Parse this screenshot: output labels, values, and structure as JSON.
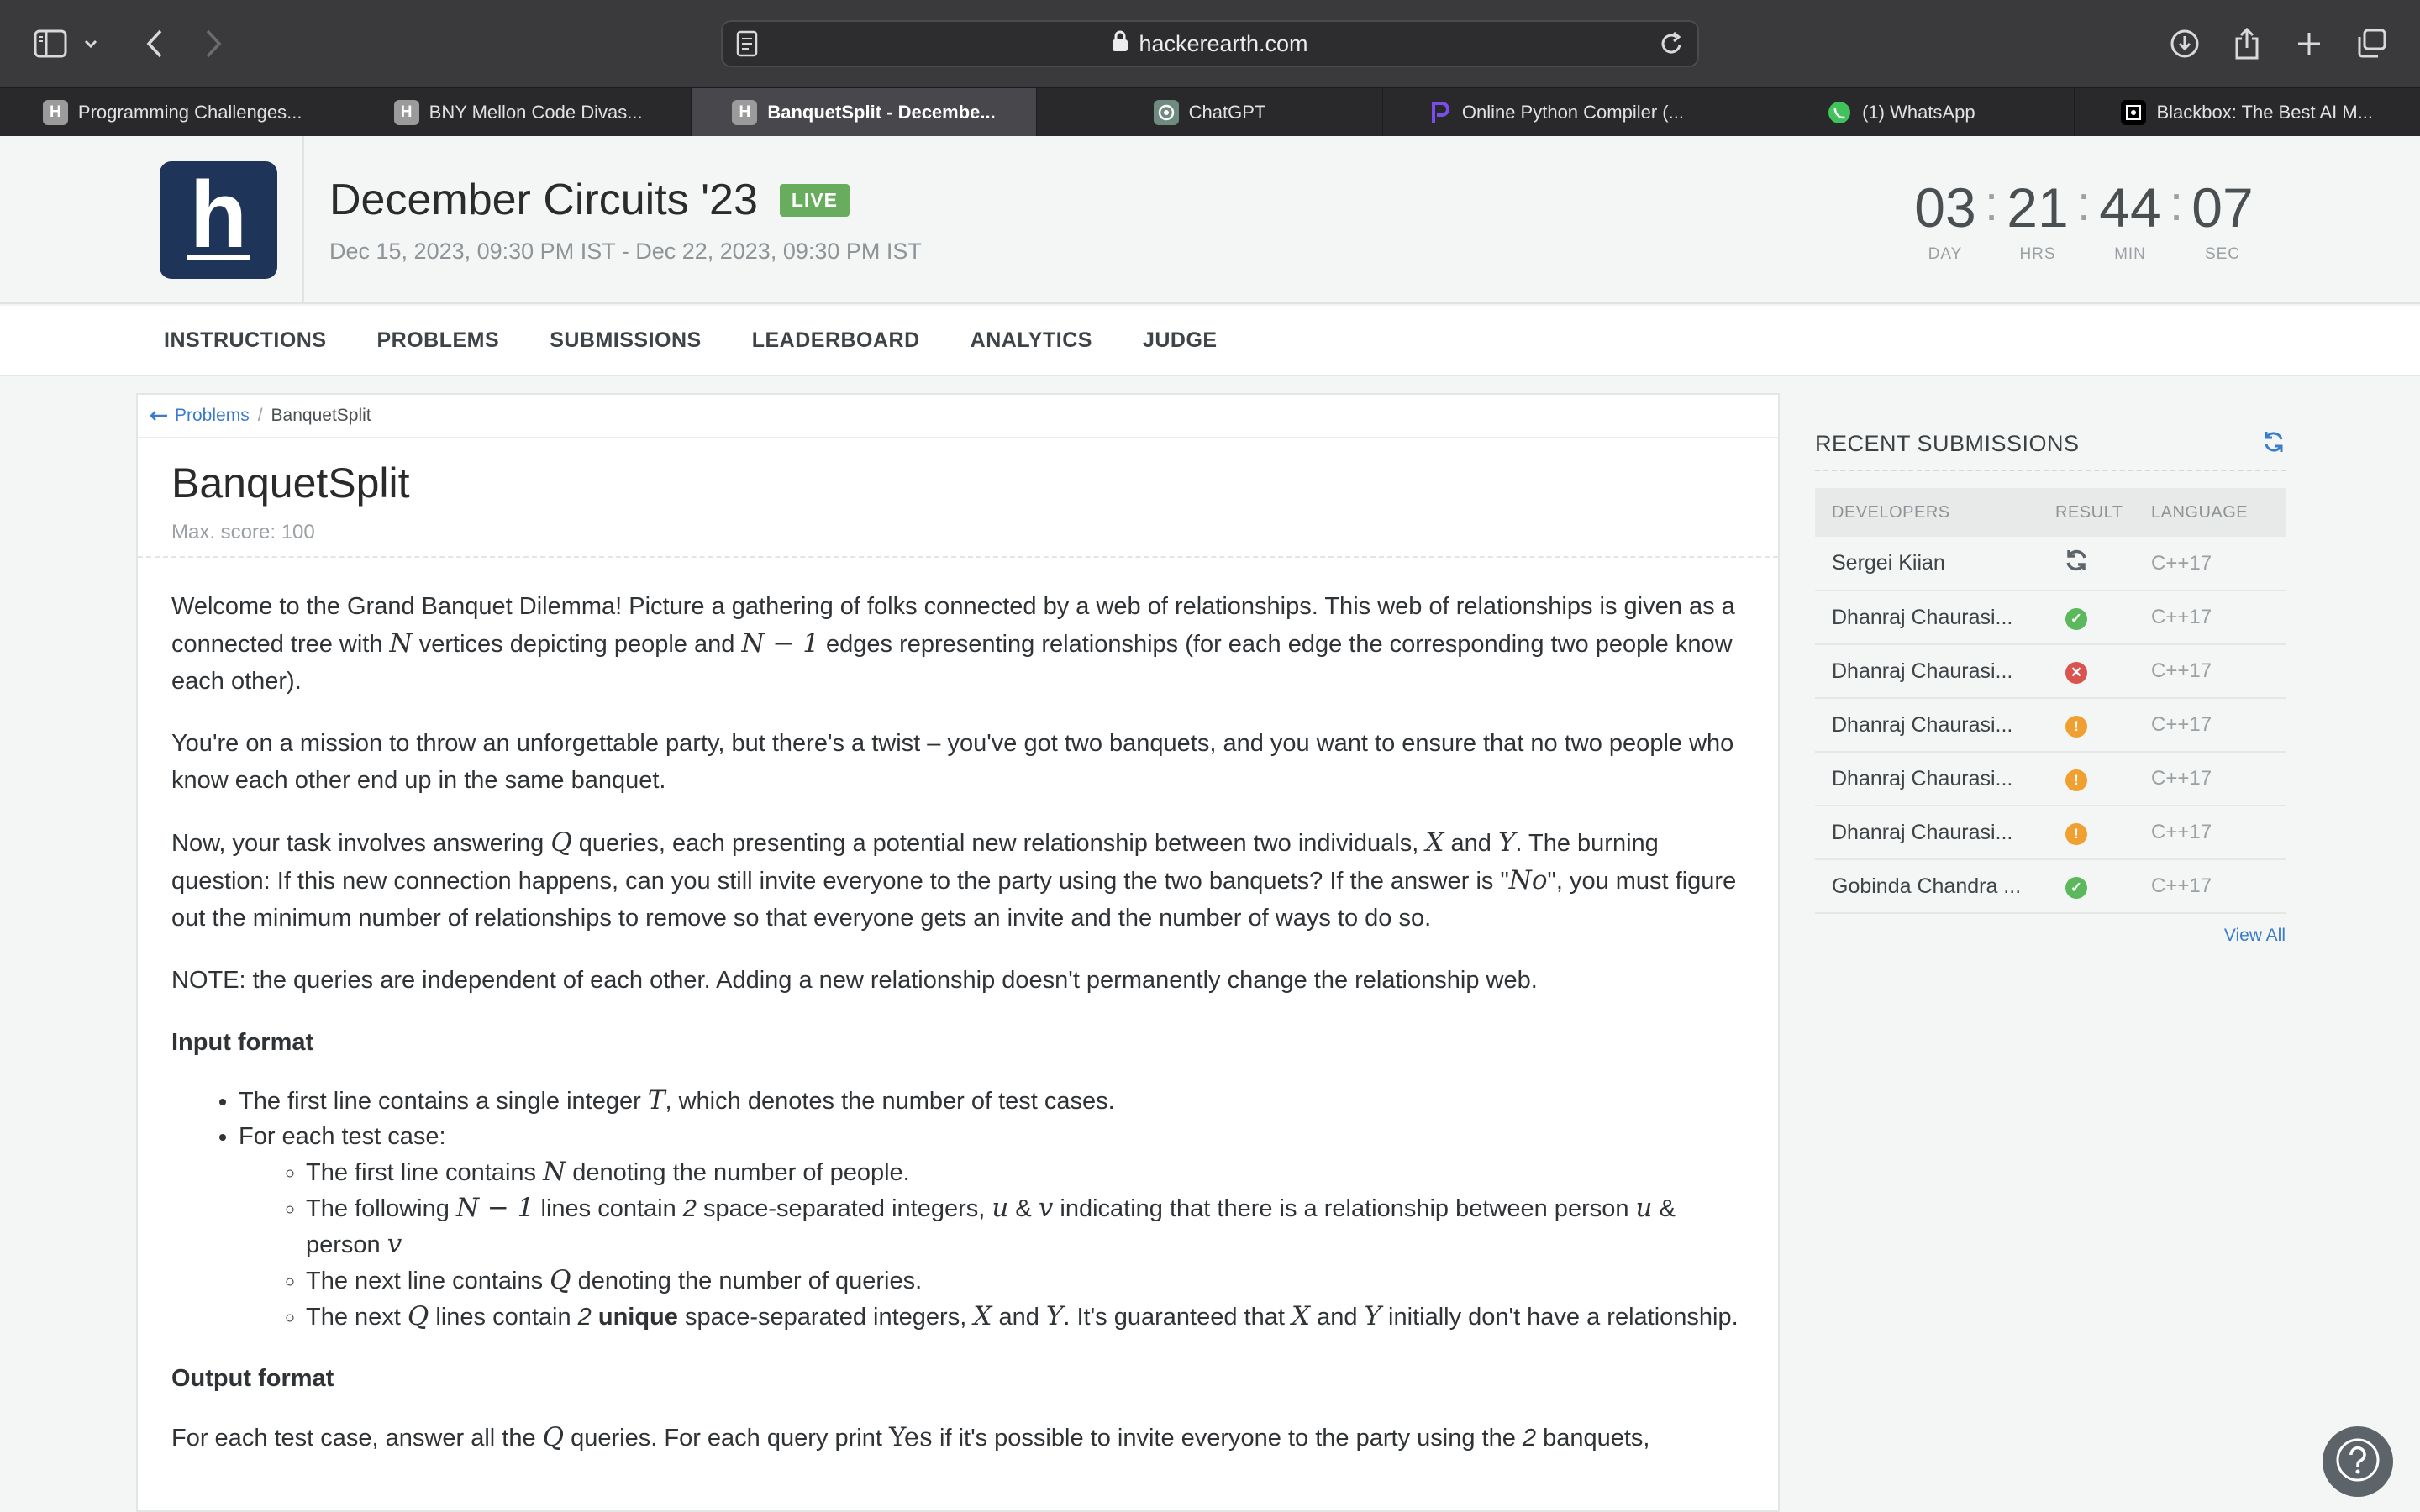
{
  "browser": {
    "url": "hackerearth.com",
    "tabs": [
      {
        "label": "Programming Challenges...",
        "favicon": "H",
        "favicon_color": "#9b9b9b"
      },
      {
        "label": "BNY Mellon Code Divas...",
        "favicon": "H",
        "favicon_color": "#9b9b9b"
      },
      {
        "label": "BanquetSplit - Decembe...",
        "favicon": "H",
        "favicon_color": "#9b9b9b"
      },
      {
        "label": "ChatGPT",
        "favicon": "openai-icon",
        "favicon_color": "#6f8a7f"
      },
      {
        "label": "Online Python Compiler (...",
        "favicon": "p-logo-icon",
        "favicon_color": "#7a4ee8"
      },
      {
        "label": "(1) WhatsApp",
        "favicon": "whatsapp-icon",
        "favicon_color": "#3fc35a"
      },
      {
        "label": "Blackbox: The Best AI M...",
        "favicon": "blackbox-icon",
        "favicon_color": "#000000"
      }
    ]
  },
  "event": {
    "title": "December Circuits '23",
    "badge": "LIVE",
    "dates": "Dec 15, 2023, 09:30 PM IST - Dec 22, 2023, 09:30 PM IST",
    "countdown": [
      {
        "value": "03",
        "label": "DAY"
      },
      {
        "value": "21",
        "label": "HRS"
      },
      {
        "value": "44",
        "label": "MIN"
      },
      {
        "value": "07",
        "label": "SEC"
      }
    ]
  },
  "nav": [
    "INSTRUCTIONS",
    "PROBLEMS",
    "SUBMISSIONS",
    "LEADERBOARD",
    "ANALYTICS",
    "JUDGE"
  ],
  "breadcrumb": {
    "back": "Problems",
    "separator": "/",
    "current": "BanquetSplit"
  },
  "problem": {
    "title": "BanquetSplit",
    "max_score": "Max. score: 100",
    "p1": {
      "a": "Welcome to the Grand Banquet Dilemma! Picture a gathering of folks connected by a web of relationships. This web of relationships is given as a connected tree with ",
      "b": " vertices depicting people and ",
      "c": " edges representing relationships (for each edge the corresponding two people know each other)."
    },
    "p2": "You're on a mission to throw an unforgettable party, but there's a twist – you've got two banquets, and you want to ensure that no two people who know each other end up in the same banquet.",
    "p3": {
      "a": "Now, your task involves answering ",
      "b": " queries, each presenting a potential new relationship between two individuals, ",
      "c": " and ",
      "d": ". The burning question: If this new connection happens, can you still invite everyone to the party using the two banquets? If the answer is \"",
      "e": "\", you must figure out the minimum number of relationships to remove so that everyone gets an invite and the number of ways to do so."
    },
    "p4": "NOTE: the queries are independent of each other. Adding a new relationship doesn't permanently change the relationship web.",
    "input_heading": "Input format",
    "in1": {
      "a": "The first line contains a single integer ",
      "b": ", which denotes the number of test cases."
    },
    "in2": "For each test case:",
    "in3": {
      "a": "The first line contains ",
      "b": " denoting the number of people."
    },
    "in4": {
      "a": "The following ",
      "b": " lines contain ",
      "c": " space-separated integers, ",
      "d": " & ",
      "e": " indicating that there is a relationship between person ",
      "f": " & person "
    },
    "in5": {
      "a": "The next line contains ",
      "b": " denoting the number of queries."
    },
    "in6": {
      "a": "The next ",
      "b": " lines contain ",
      "c": " ",
      "d": "unique",
      "e": " space-separated integers, ",
      "f": " and ",
      "g": ". It's guaranteed that ",
      "h": " and ",
      "i": " initially don't have a relationship."
    },
    "output_heading": "Output format",
    "out1": {
      "a": "For each test case, answer all the ",
      "b": " queries. For each query print ",
      "c": " if it's possible to invite everyone to the party using the ",
      "d": " banquets,"
    },
    "math": {
      "N": "N",
      "N_minus_1": "N − 1",
      "Q": "Q",
      "X": "X",
      "Y": "Y",
      "No": "No",
      "T": "T",
      "two": "2",
      "u": "u",
      "v": "v",
      "Yes": "Yes"
    }
  },
  "recent": {
    "title": "RECENT SUBMISSIONS",
    "columns": [
      "DEVELOPERS",
      "RESULT",
      "LANGUAGE"
    ],
    "rows": [
      {
        "developer": "Sergei Kiian",
        "result": "processing",
        "language": "C++17"
      },
      {
        "developer": "Dhanraj Chaurasi...",
        "result": "accepted",
        "language": "C++17"
      },
      {
        "developer": "Dhanraj Chaurasi...",
        "result": "wrong",
        "language": "C++17"
      },
      {
        "developer": "Dhanraj Chaurasi...",
        "result": "partial",
        "language": "C++17"
      },
      {
        "developer": "Dhanraj Chaurasi...",
        "result": "partial",
        "language": "C++17"
      },
      {
        "developer": "Dhanraj Chaurasi...",
        "result": "partial",
        "language": "C++17"
      },
      {
        "developer": "Gobinda Chandra ...",
        "result": "accepted",
        "language": "C++17"
      }
    ],
    "view_all": "View All"
  },
  "colors": {
    "accepted": "#5cb85c",
    "wrong": "#d9534f",
    "partial": "#f0a030",
    "link": "#3a7ccc",
    "live": "#68ac5e",
    "logo_bg": "#1f3459"
  }
}
